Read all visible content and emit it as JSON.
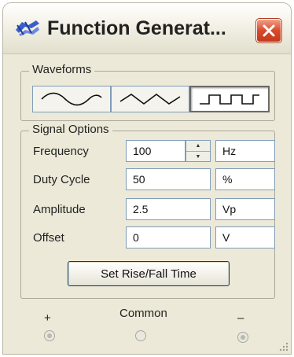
{
  "window": {
    "title": "Function Generat...",
    "close_label": "×"
  },
  "waveforms": {
    "label": "Waveforms",
    "options": [
      {
        "name": "sine-wave-icon",
        "selected": false
      },
      {
        "name": "triangle-wave-icon",
        "selected": false
      },
      {
        "name": "square-wave-icon",
        "selected": true
      }
    ]
  },
  "signal_options": {
    "label": "Signal Options",
    "rows": [
      {
        "label": "Frequency",
        "value": "100",
        "unit": "Hz"
      },
      {
        "label": "Duty Cycle",
        "value": "50",
        "unit": "%"
      },
      {
        "label": "Amplitude",
        "value": "2.5",
        "unit": "Vp"
      },
      {
        "label": "Offset",
        "value": "0",
        "unit": "V"
      }
    ],
    "rise_fall_button": "Set Rise/Fall Time"
  },
  "terminals": {
    "plus": "+",
    "common": "Common",
    "minus": "–"
  },
  "colors": {
    "window_bg": "#ece9d8",
    "close_red": "#d84a2a",
    "field_border": "#7f9db9"
  }
}
